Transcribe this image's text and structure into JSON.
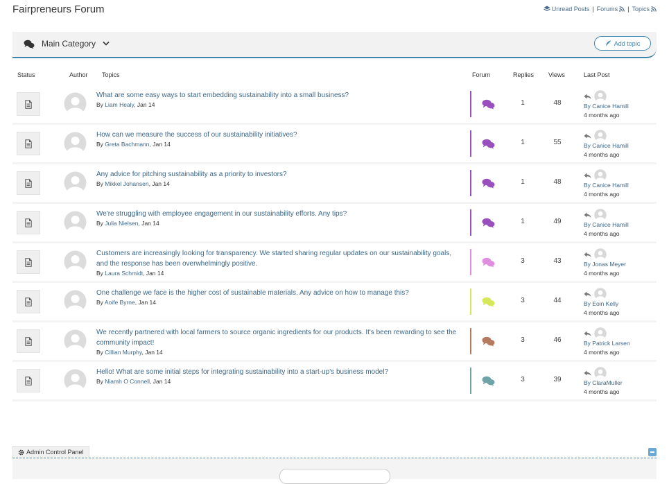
{
  "site": {
    "title": "Fairpreneurs Forum"
  },
  "toplinks": {
    "unread": "Unread Posts",
    "forums": "Forums",
    "topics": "Topics",
    "sep": "|"
  },
  "category": {
    "name": "Main Category",
    "add_topic": "Add topic"
  },
  "columns": {
    "status": "Status",
    "author": "Author",
    "topics": "Topics",
    "forum": "Forum",
    "replies": "Replies",
    "views": "Views",
    "last_post": "Last Post"
  },
  "topics": [
    {
      "title": "What are some easy ways to start embedding sustainability into a small business?",
      "by": "By ",
      "author": "Liam Healy",
      "date": ", Jan 14",
      "forum_color": "#9a4fbf",
      "replies": "1",
      "views": "48",
      "last_by": "By Canice Hamill",
      "last_ago": "4 months ago"
    },
    {
      "title": "How can we measure the success of our sustainability initiatives?",
      "by": "By ",
      "author": "Greta Bachmann",
      "date": ", Jan 14",
      "forum_color": "#9a4fbf",
      "replies": "1",
      "views": "55",
      "last_by": "By Canice Hamill",
      "last_ago": "4 months ago"
    },
    {
      "title": "Any advice for pitching sustainability as a priority to investors?",
      "by": "By ",
      "author": "Mikkel Johansen",
      "date": ", Jan 14",
      "forum_color": "#9a4fbf",
      "replies": "1",
      "views": "48",
      "last_by": "By Canice Hamill",
      "last_ago": "4 months ago"
    },
    {
      "title": "We're struggling with employee engagement in our sustainability efforts. Any tips?",
      "by": "By ",
      "author": "Julia Nielsen",
      "date": ", Jan 14",
      "forum_color": "#9a4fbf",
      "replies": "1",
      "views": "49",
      "last_by": "By Canice Hamill",
      "last_ago": "4 months ago"
    },
    {
      "title": "Customers are increasingly looking for transparency. We started sharing regular updates on our sustainability goals, and the response has been overwhelmingly positive.",
      "by": "By ",
      "author": "Laura Schmidt",
      "date": ", Jan 14",
      "forum_color": "#e08fe0",
      "replies": "3",
      "views": "43",
      "last_by": "By Jonas Meyer",
      "last_ago": "4 months ago"
    },
    {
      "title": "One challenge we face is the higher cost of sustainable materials. Any advice on how to manage this?",
      "by": "By ",
      "author": "Aoife Byrne",
      "date": ", Jan 14",
      "forum_color": "#d6e85a",
      "replies": "3",
      "views": "44",
      "last_by": "By Eoin Kelly",
      "last_ago": "4 months ago"
    },
    {
      "title": "We recently partnered with local farmers to source organic ingredients for our products. It's been rewarding to see the community impact!",
      "by": "By ",
      "author": "Cillian Murphy",
      "date": ", Jan 14",
      "forum_color": "#b57a5f",
      "replies": "3",
      "views": "46",
      "last_by": "By Patrick Larsen",
      "last_ago": "4 months ago"
    },
    {
      "title": "Hello! What are some initial steps for integrating sustainability into a start-up's business model?",
      "by": "By ",
      "author": "Niamh O Connell",
      "date": ", Jan 14",
      "forum_color": "#6fa3a8",
      "replies": "3",
      "views": "39",
      "last_by": "By ClaraMuller",
      "last_ago": "4 months ago"
    }
  ],
  "admin": {
    "label": "Admin Control Panel"
  }
}
